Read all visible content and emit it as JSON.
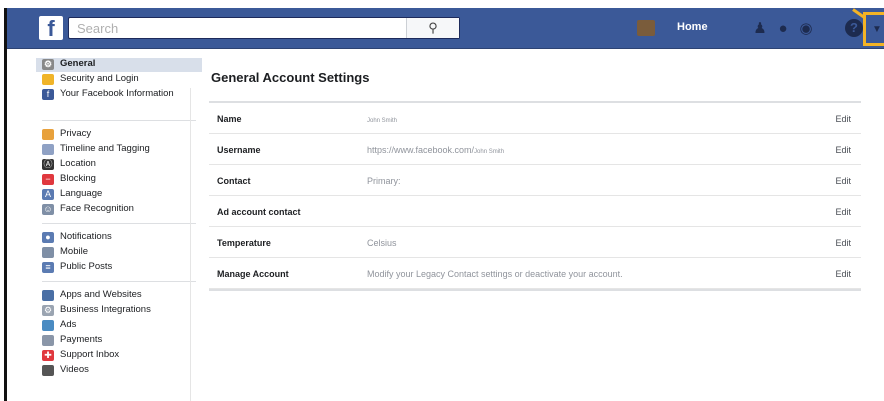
{
  "header": {
    "logo_letter": "f",
    "search_placeholder": "Search",
    "search_button_icon": "magnifier-icon",
    "home_label": "Home",
    "help_glyph": "?",
    "icons": [
      "friends-icon",
      "messenger-icon",
      "notifications-icon",
      "help-icon",
      "dropdown-icon"
    ],
    "highlight_color": "#f3b325"
  },
  "sidebar": {
    "groups": [
      [
        {
          "label": "General",
          "icon": "gear-icon",
          "active": true
        },
        {
          "label": "Security and Login",
          "icon": "shield-icon"
        },
        {
          "label": "Your Facebook Information",
          "icon": "facebook-icon"
        }
      ],
      [
        {
          "label": "Privacy",
          "icon": "lock-icon"
        },
        {
          "label": "Timeline and Tagging",
          "icon": "timeline-icon"
        },
        {
          "label": "Location",
          "icon": "location-icon"
        },
        {
          "label": "Blocking",
          "icon": "blocking-icon"
        },
        {
          "label": "Language",
          "icon": "language-icon"
        },
        {
          "label": "Face Recognition",
          "icon": "face-icon"
        }
      ],
      [
        {
          "label": "Notifications",
          "icon": "globe-icon"
        },
        {
          "label": "Mobile",
          "icon": "mobile-icon"
        },
        {
          "label": "Public Posts",
          "icon": "rss-icon"
        }
      ],
      [
        {
          "label": "Apps and Websites",
          "icon": "apps-icon"
        },
        {
          "label": "Business Integrations",
          "icon": "business-icon"
        },
        {
          "label": "Ads",
          "icon": "ads-icon"
        },
        {
          "label": "Payments",
          "icon": "payments-icon"
        },
        {
          "label": "Support Inbox",
          "icon": "support-icon"
        },
        {
          "label": "Videos",
          "icon": "videos-icon"
        }
      ]
    ]
  },
  "main": {
    "title": "General Account Settings",
    "edit_label": "Edit",
    "rows": [
      {
        "label": "Name",
        "value": "",
        "value_small": "John Smith"
      },
      {
        "label": "Username",
        "value": "https://www.facebook.com/",
        "value_small": "John Smith"
      },
      {
        "label": "Contact",
        "value": "Primary:",
        "value_small": ""
      },
      {
        "label": "Ad account contact",
        "value": "",
        "value_small": ""
      },
      {
        "label": "Temperature",
        "value": "Celsius",
        "value_small": ""
      },
      {
        "label": "Manage Account",
        "value": "Modify your Legacy Contact settings or deactivate your account.",
        "value_small": ""
      }
    ]
  }
}
